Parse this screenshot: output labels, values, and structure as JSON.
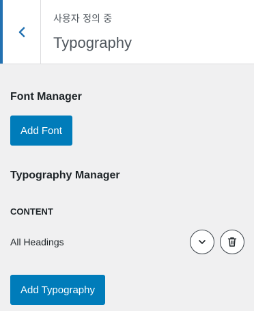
{
  "header": {
    "subtitle": "사용자 정의 중",
    "title": "Typography",
    "back_icon": "chevron-left-icon",
    "accent_color": "#2271b1"
  },
  "font_manager": {
    "heading": "Font Manager",
    "add_button": "Add Font"
  },
  "typography_manager": {
    "heading": "Typography Manager",
    "group_label": "CONTENT",
    "items": [
      {
        "label": "All Headings",
        "expand_icon": "chevron-down-icon",
        "delete_icon": "trash-icon"
      }
    ],
    "add_button": "Add Typography"
  },
  "colors": {
    "button": "#007cba",
    "background": "#f0f0f1"
  }
}
